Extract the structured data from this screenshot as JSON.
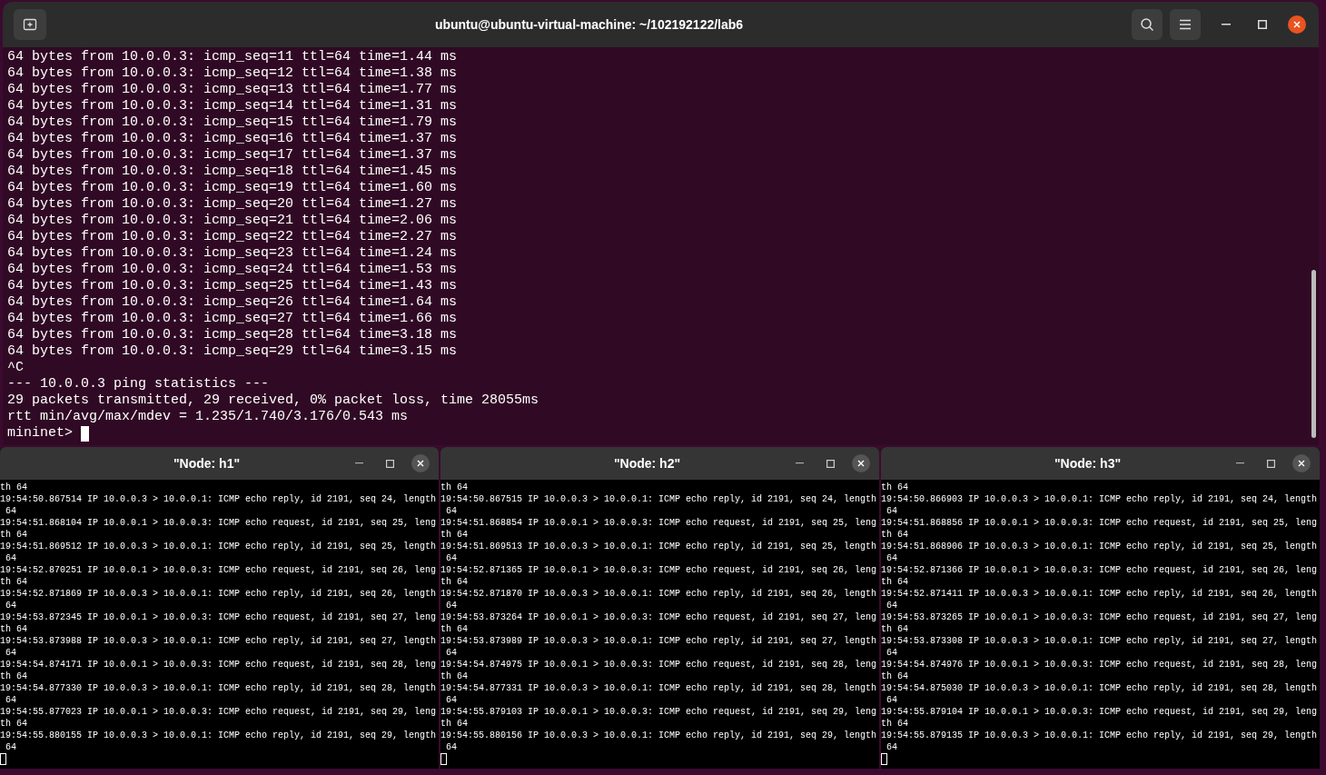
{
  "terminal": {
    "title": "ubuntu@ubuntu-virtual-machine: ~/102192122/lab6",
    "lines": [
      "64 bytes from 10.0.0.3: icmp_seq=11 ttl=64 time=1.44 ms",
      "64 bytes from 10.0.0.3: icmp_seq=12 ttl=64 time=1.38 ms",
      "64 bytes from 10.0.0.3: icmp_seq=13 ttl=64 time=1.77 ms",
      "64 bytes from 10.0.0.3: icmp_seq=14 ttl=64 time=1.31 ms",
      "64 bytes from 10.0.0.3: icmp_seq=15 ttl=64 time=1.79 ms",
      "64 bytes from 10.0.0.3: icmp_seq=16 ttl=64 time=1.37 ms",
      "64 bytes from 10.0.0.3: icmp_seq=17 ttl=64 time=1.37 ms",
      "64 bytes from 10.0.0.3: icmp_seq=18 ttl=64 time=1.45 ms",
      "64 bytes from 10.0.0.3: icmp_seq=19 ttl=64 time=1.60 ms",
      "64 bytes from 10.0.0.3: icmp_seq=20 ttl=64 time=1.27 ms",
      "64 bytes from 10.0.0.3: icmp_seq=21 ttl=64 time=2.06 ms",
      "64 bytes from 10.0.0.3: icmp_seq=22 ttl=64 time=2.27 ms",
      "64 bytes from 10.0.0.3: icmp_seq=23 ttl=64 time=1.24 ms",
      "64 bytes from 10.0.0.3: icmp_seq=24 ttl=64 time=1.53 ms",
      "64 bytes from 10.0.0.3: icmp_seq=25 ttl=64 time=1.43 ms",
      "64 bytes from 10.0.0.3: icmp_seq=26 ttl=64 time=1.64 ms",
      "64 bytes from 10.0.0.3: icmp_seq=27 ttl=64 time=1.66 ms",
      "64 bytes from 10.0.0.3: icmp_seq=28 ttl=64 time=3.18 ms",
      "64 bytes from 10.0.0.3: icmp_seq=29 ttl=64 time=3.15 ms",
      "^C",
      "--- 10.0.0.3 ping statistics ---",
      "29 packets transmitted, 29 received, 0% packet loss, time 28055ms",
      "rtt min/avg/max/mdev = 1.235/1.740/3.176/0.543 ms"
    ],
    "prompt": "mininet>"
  },
  "node_windows": [
    {
      "title": "\"Node: h1\"",
      "lines": [
        "th 64",
        "19:54:50.867514 IP 10.0.0.3 > 10.0.0.1: ICMP echo reply, id 2191, seq 24, length",
        " 64",
        "19:54:51.868104 IP 10.0.0.1 > 10.0.0.3: ICMP echo request, id 2191, seq 25, leng",
        "th 64",
        "19:54:51.869512 IP 10.0.0.3 > 10.0.0.1: ICMP echo reply, id 2191, seq 25, length",
        " 64",
        "19:54:52.870251 IP 10.0.0.1 > 10.0.0.3: ICMP echo request, id 2191, seq 26, leng",
        "th 64",
        "19:54:52.871869 IP 10.0.0.3 > 10.0.0.1: ICMP echo reply, id 2191, seq 26, length",
        " 64",
        "19:54:53.872345 IP 10.0.0.1 > 10.0.0.3: ICMP echo request, id 2191, seq 27, leng",
        "th 64",
        "19:54:53.873988 IP 10.0.0.3 > 10.0.0.1: ICMP echo reply, id 2191, seq 27, length",
        " 64",
        "19:54:54.874171 IP 10.0.0.1 > 10.0.0.3: ICMP echo request, id 2191, seq 28, leng",
        "th 64",
        "19:54:54.877330 IP 10.0.0.3 > 10.0.0.1: ICMP echo reply, id 2191, seq 28, length",
        " 64",
        "19:54:55.877023 IP 10.0.0.1 > 10.0.0.3: ICMP echo request, id 2191, seq 29, leng",
        "th 64",
        "19:54:55.880155 IP 10.0.0.3 > 10.0.0.1: ICMP echo reply, id 2191, seq 29, length",
        " 64"
      ]
    },
    {
      "title": "\"Node: h2\"",
      "lines": [
        "th 64",
        "19:54:50.867515 IP 10.0.0.3 > 10.0.0.1: ICMP echo reply, id 2191, seq 24, length",
        " 64",
        "19:54:51.868854 IP 10.0.0.1 > 10.0.0.3: ICMP echo request, id 2191, seq 25, leng",
        "th 64",
        "19:54:51.869513 IP 10.0.0.3 > 10.0.0.1: ICMP echo reply, id 2191, seq 25, length",
        " 64",
        "19:54:52.871365 IP 10.0.0.1 > 10.0.0.3: ICMP echo request, id 2191, seq 26, leng",
        "th 64",
        "19:54:52.871870 IP 10.0.0.3 > 10.0.0.1: ICMP echo reply, id 2191, seq 26, length",
        " 64",
        "19:54:53.873264 IP 10.0.0.1 > 10.0.0.3: ICMP echo request, id 2191, seq 27, leng",
        "th 64",
        "19:54:53.873989 IP 10.0.0.3 > 10.0.0.1: ICMP echo reply, id 2191, seq 27, length",
        " 64",
        "19:54:54.874975 IP 10.0.0.1 > 10.0.0.3: ICMP echo request, id 2191, seq 28, leng",
        "th 64",
        "19:54:54.877331 IP 10.0.0.3 > 10.0.0.1: ICMP echo reply, id 2191, seq 28, length",
        " 64",
        "19:54:55.879103 IP 10.0.0.1 > 10.0.0.3: ICMP echo request, id 2191, seq 29, leng",
        "th 64",
        "19:54:55.880156 IP 10.0.0.3 > 10.0.0.1: ICMP echo reply, id 2191, seq 29, length",
        " 64"
      ]
    },
    {
      "title": "\"Node: h3\"",
      "lines": [
        "th 64",
        "19:54:50.866903 IP 10.0.0.3 > 10.0.0.1: ICMP echo reply, id 2191, seq 24, length",
        " 64",
        "19:54:51.868856 IP 10.0.0.1 > 10.0.0.3: ICMP echo request, id 2191, seq 25, leng",
        "th 64",
        "19:54:51.868906 IP 10.0.0.3 > 10.0.0.1: ICMP echo reply, id 2191, seq 25, length",
        " 64",
        "19:54:52.871366 IP 10.0.0.1 > 10.0.0.3: ICMP echo request, id 2191, seq 26, leng",
        "th 64",
        "19:54:52.871411 IP 10.0.0.3 > 10.0.0.1: ICMP echo reply, id 2191, seq 26, length",
        " 64",
        "19:54:53.873265 IP 10.0.0.1 > 10.0.0.3: ICMP echo request, id 2191, seq 27, leng",
        "th 64",
        "19:54:53.873308 IP 10.0.0.3 > 10.0.0.1: ICMP echo reply, id 2191, seq 27, length",
        " 64",
        "19:54:54.874976 IP 10.0.0.1 > 10.0.0.3: ICMP echo request, id 2191, seq 28, leng",
        "th 64",
        "19:54:54.875030 IP 10.0.0.3 > 10.0.0.1: ICMP echo reply, id 2191, seq 28, length",
        " 64",
        "19:54:55.879104 IP 10.0.0.1 > 10.0.0.3: ICMP echo request, id 2191, seq 29, leng",
        "th 64",
        "19:54:55.879135 IP 10.0.0.3 > 10.0.0.1: ICMP echo reply, id 2191, seq 29, length",
        " 64"
      ]
    }
  ]
}
